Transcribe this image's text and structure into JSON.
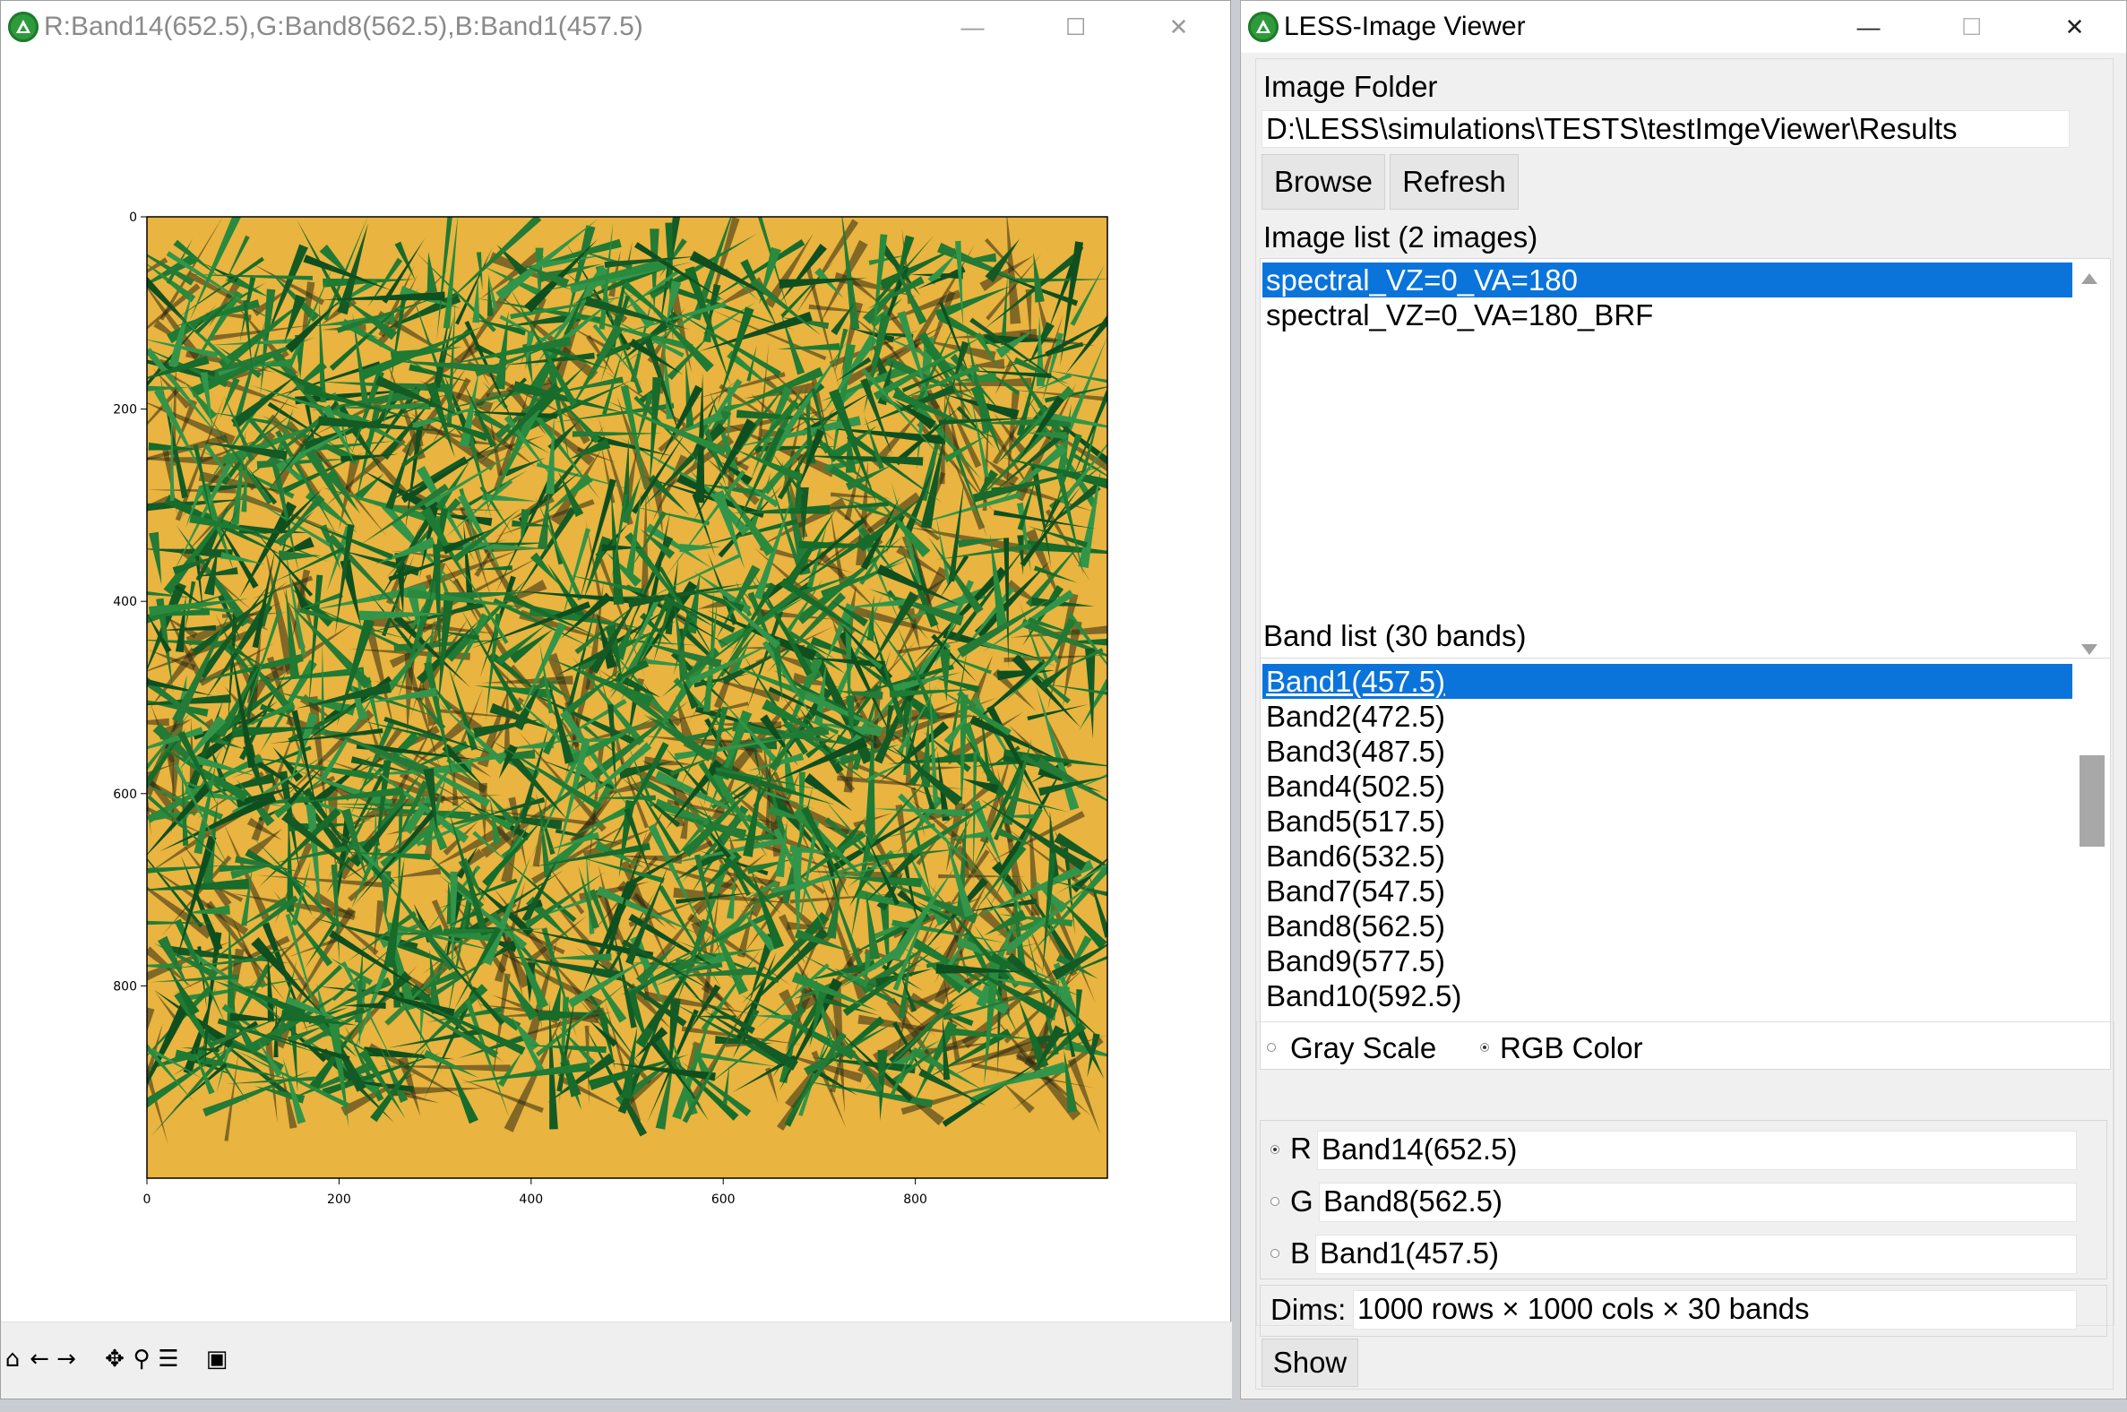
{
  "figure_window": {
    "title": "R:Band14(652.5),G:Band8(562.5),B:Band1(457.5)",
    "controls": {
      "minimize": "—",
      "maximize": "☐",
      "close": "✕"
    },
    "plot": {
      "x_ticks": [
        "0",
        "200",
        "400",
        "600",
        "800"
      ],
      "y_ticks": [
        "0",
        "200",
        "400",
        "600",
        "800"
      ],
      "image_background": "#e9b43f",
      "vegetation_color": "#1f7a34"
    },
    "toolbar": {
      "home": "⌂",
      "back": "←",
      "forward": "→",
      "pan": "✥",
      "zoom": "⚲",
      "configure": "☰",
      "save": "▣"
    }
  },
  "viewer_window": {
    "title": "LESS-Image Viewer",
    "controls": {
      "minimize": "—",
      "maximize": "☐",
      "close": "✕"
    },
    "image_folder_label": "Image Folder",
    "image_folder_path": "D:\\LESS\\simulations\\TESTS\\testImgeViewer\\Results",
    "browse_label": "Browse",
    "refresh_label": "Refresh",
    "image_list_label": "Image list (2 images)",
    "images": [
      {
        "label": "spectral_VZ=0_VA=180",
        "selected": true
      },
      {
        "label": "spectral_VZ=0_VA=180_BRF",
        "selected": false
      }
    ],
    "band_list_label": "Band list (30 bands)",
    "bands": [
      {
        "label": "Band1(457.5)",
        "selected": true
      },
      {
        "label": "Band2(472.5)",
        "selected": false
      },
      {
        "label": "Band3(487.5)",
        "selected": false
      },
      {
        "label": "Band4(502.5)",
        "selected": false
      },
      {
        "label": "Band5(517.5)",
        "selected": false
      },
      {
        "label": "Band6(532.5)",
        "selected": false
      },
      {
        "label": "Band7(547.5)",
        "selected": false
      },
      {
        "label": "Band8(562.5)",
        "selected": false
      },
      {
        "label": "Band9(577.5)",
        "selected": false
      },
      {
        "label": "Band10(592.5)",
        "selected": false
      }
    ],
    "mode_gray_label": "Gray Scale",
    "mode_rgb_label": "RGB Color",
    "mode_selected": "rgb",
    "r_label": "R",
    "r_value": "Band14(652.5)",
    "g_label": "G",
    "g_value": "Band8(562.5)",
    "b_label": "B",
    "b_value": "Band1(457.5)",
    "channel_selected": "R",
    "dims_label": "Dims:",
    "dims_value": "1000 rows × 1000 cols × 30 bands",
    "show_label": "Show",
    "selection_color": "#0a74da"
  }
}
